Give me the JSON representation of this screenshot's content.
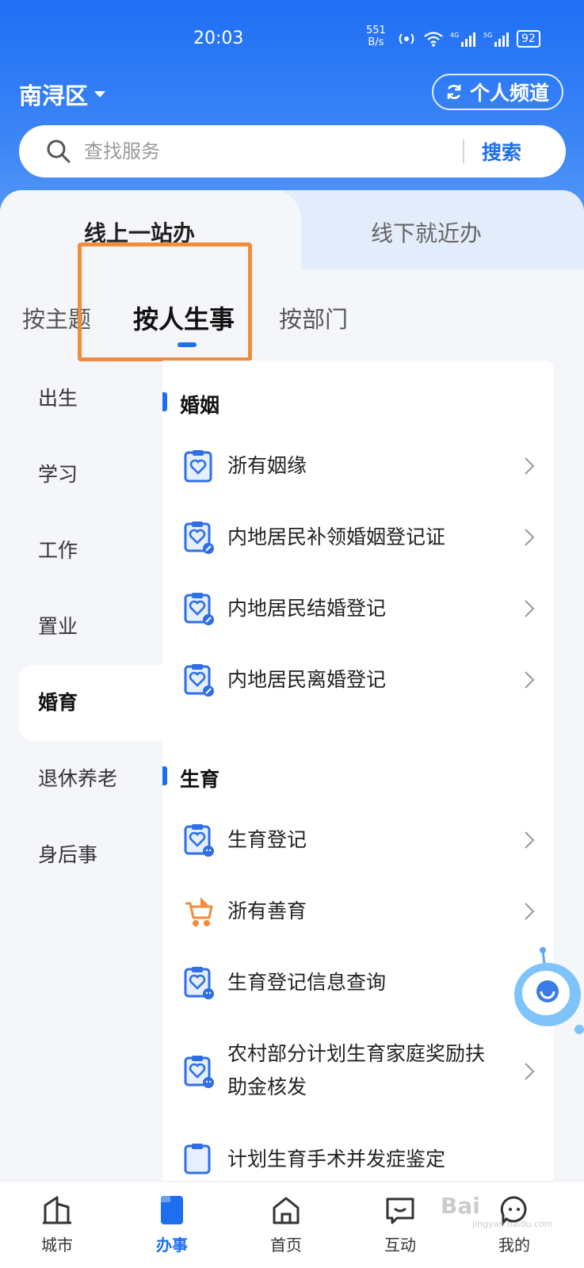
{
  "status_bar": {
    "time": "20:03",
    "net_speed_value": "551",
    "net_speed_unit": "B/s",
    "battery": "92"
  },
  "header": {
    "district": "南浔区",
    "channel_button": "个人频道"
  },
  "search": {
    "placeholder": "查找服务",
    "button": "搜索"
  },
  "main_tabs": [
    {
      "label": "线上一站办",
      "active": true
    },
    {
      "label": "线下就近办",
      "active": false
    }
  ],
  "sub_tabs": [
    {
      "label": "按主题"
    },
    {
      "label": "按人生事",
      "active": true
    },
    {
      "label": "按部门"
    }
  ],
  "sidebar": {
    "items": [
      {
        "label": "出生"
      },
      {
        "label": "学习"
      },
      {
        "label": "工作"
      },
      {
        "label": "置业"
      },
      {
        "label": "婚育",
        "active": true
      },
      {
        "label": "退休养老"
      },
      {
        "label": "身后事"
      }
    ]
  },
  "sections": [
    {
      "title": "婚姻",
      "items": [
        {
          "label": "浙有姻缘",
          "icon": "heart-clipboard-icon"
        },
        {
          "label": "内地居民补领婚姻登记证",
          "icon": "heart-clipboard-pen-icon"
        },
        {
          "label": "内地居民结婚登记",
          "icon": "heart-clipboard-pen-icon"
        },
        {
          "label": "内地居民离婚登记",
          "icon": "heart-clipboard-pen-icon"
        }
      ]
    },
    {
      "title": "生育",
      "items": [
        {
          "label": "生育登记",
          "icon": "heart-clipboard-baby-icon"
        },
        {
          "label": "浙有善育",
          "icon": "stroller-icon"
        },
        {
          "label": "生育登记信息查询",
          "icon": "heart-clipboard-baby-icon"
        },
        {
          "label_line1": "农村部分计划生育家庭奖励扶",
          "label_line2": "助金核发",
          "icon": "heart-clipboard-baby-icon"
        },
        {
          "label": "计划生育手术并发症鉴定",
          "icon": "heart-clipboard-baby-icon"
        }
      ]
    }
  ],
  "bottom_nav": [
    {
      "label": "城市",
      "icon": "city-icon"
    },
    {
      "label": "办事",
      "icon": "handle-affairs-icon",
      "active": true
    },
    {
      "label": "首页",
      "icon": "home-icon"
    },
    {
      "label": "互动",
      "icon": "chat-icon"
    },
    {
      "label": "我的",
      "icon": "profile-icon"
    }
  ],
  "watermark": {
    "text": "Bai",
    "sub": "jingyan.baidu.com"
  },
  "colors": {
    "brand_blue": "#1e6ff0",
    "highlight_orange": "#f08c3c"
  }
}
